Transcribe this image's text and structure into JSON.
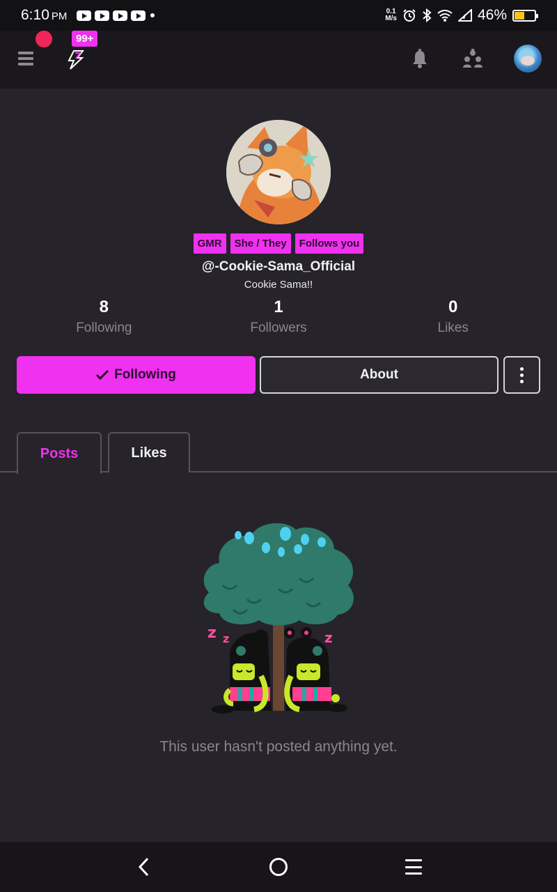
{
  "status_bar": {
    "time": "6:10",
    "ampm": "PM",
    "net_speed_top": "0.1",
    "net_speed_bottom": "M/s",
    "battery_percent": "46%",
    "battery_level": 0.46
  },
  "header": {
    "notification_badge": "99+"
  },
  "profile": {
    "tags": [
      "GMR",
      "She / They",
      "Follows you"
    ],
    "username": "@-Cookie-Sama_Official",
    "display_name": "Cookie Sama!!"
  },
  "stats": [
    {
      "value": "8",
      "label": "Following"
    },
    {
      "value": "1",
      "label": "Followers"
    },
    {
      "value": "0",
      "label": "Likes"
    }
  ],
  "actions": {
    "following_label": "Following",
    "about_label": "About"
  },
  "tabs": [
    {
      "label": "Posts",
      "active": true
    },
    {
      "label": "Likes",
      "active": false
    }
  ],
  "empty_state": {
    "message": "This user hasn't posted anything yet."
  },
  "colors": {
    "accent": "#f031ef",
    "background": "#26232b",
    "record_dot": "#f0265a"
  }
}
